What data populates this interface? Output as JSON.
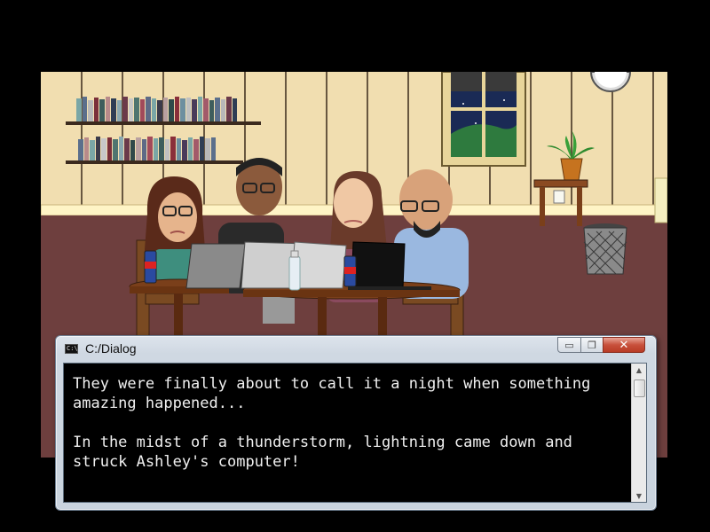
{
  "window": {
    "title": "C:/Dialog",
    "icon": "console-icon",
    "icon_text": "C:\\",
    "minimize_glyph": "▭",
    "maximize_glyph": "❐",
    "close_glyph": "✕"
  },
  "dialog": {
    "text": "They were finally about to call it a night when something\namazing happened...\n\nIn the midst of a thunderstorm, lightning came down and\nstruck Ashley's computer!"
  },
  "scrollbar": {
    "up_glyph": "▲",
    "down_glyph": "▼"
  },
  "scene": {
    "description_icons": [
      "bookshelf-icon",
      "window-icon",
      "clock-icon",
      "plant-icon",
      "trash-can-icon",
      "table-icon",
      "laptop-icon"
    ],
    "colors": {
      "wall": "#f1deb0",
      "wall_trim": "#fff4c6",
      "floor": "#6e3f3e",
      "wood": "#6b3f22"
    }
  }
}
